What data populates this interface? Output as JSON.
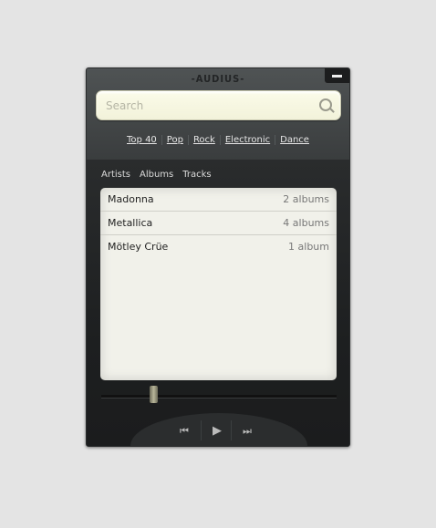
{
  "app": {
    "title": "-AUDIUS-"
  },
  "search": {
    "placeholder": "Search",
    "value": ""
  },
  "genres": [
    "Top 40",
    "Pop",
    "Rock",
    "Electronic",
    "Dance"
  ],
  "tabs": [
    "Artists",
    "Albums",
    "Tracks"
  ],
  "artists": [
    {
      "name": "Madonna",
      "count": "2 albums"
    },
    {
      "name": "Metallica",
      "count": "4 albums"
    },
    {
      "name": "Mötley Crüe",
      "count": "1 album"
    }
  ],
  "player": {
    "position": 0.22,
    "prev": "⏮",
    "play": "▶",
    "next": "⏭"
  }
}
